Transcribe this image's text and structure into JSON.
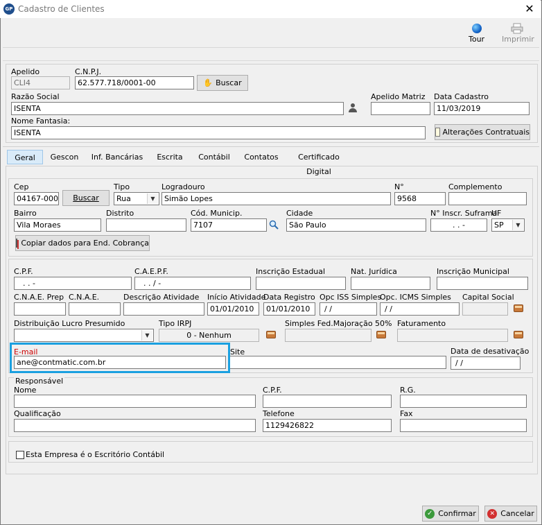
{
  "window": {
    "app_icon": "GP",
    "title": "Cadastro de Clientes",
    "close": "✕"
  },
  "toolbar": {
    "tour": "Tour",
    "imprimir": "Imprimir"
  },
  "header": {
    "apelido_label": "Apelido",
    "apelido_value": "CLI4",
    "cnpj_label": "C.N.P.J.",
    "cnpj_value": "62.577.718/0001-00",
    "buscar_label": "Buscar",
    "razao_label": "Razão Social",
    "razao_value": "ISENTA",
    "apelido_matriz_label": "Apelido Matriz",
    "apelido_matriz_value": "",
    "data_cadastro_label": "Data Cadastro",
    "data_cadastro_value": "11/03/2019",
    "nome_fantasia_label": "Nome Fantasia:",
    "nome_fantasia_value": "ISENTA",
    "alteracoes_label": "Alterações Contratuais"
  },
  "tabs": [
    "Geral",
    "Gescon",
    "Inf. Bancárias",
    "Escrita",
    "Contábil",
    "Contatos",
    "Certificado Digital"
  ],
  "address": {
    "cep_label": "Cep",
    "cep_value": "04167-000",
    "buscar_label": "Buscar",
    "tipo_label": "Tipo",
    "tipo_value": "Rua",
    "logradouro_label": "Logradouro",
    "logradouro_value": "Simão Lopes",
    "numero_label": "N°",
    "numero_value": "9568",
    "complemento_label": "Complemento",
    "complemento_value": "",
    "bairro_label": "Bairro",
    "bairro_value": "Vila Moraes",
    "distrito_label": "Distrito",
    "distrito_value": "",
    "cod_municip_label": "Cód. Municip.",
    "cod_municip_value": "7107",
    "cidade_label": "Cidade",
    "cidade_value": "São Paulo",
    "suframa_label": "N° Inscr. Suframa",
    "suframa_value": ". . -",
    "uf_label": "UF",
    "uf_value": "SP",
    "copiar_label": "Copiar dados para End. Cobrança"
  },
  "fiscal": {
    "cpf_label": "C.P.F.",
    "cpf_value": ". . -",
    "caepf_label": "C.A.E.P.F.",
    "caepf_value": ". . / -",
    "ie_label": "Inscrição Estadual",
    "ie_value": "",
    "nat_juridica_label": "Nat. Jurídica",
    "nat_juridica_value": "",
    "im_label": "Inscrição Municipal",
    "im_value": "",
    "cnae_prep_label": "C.N.A.E. Prep",
    "cnae_label": "C.N.A.E.",
    "desc_atividade_label": "Descrição Atividade",
    "inicio_atividade_label": "Início Atividade",
    "inicio_atividade_value": "01/01/2010",
    "data_registro_label": "Data Registro",
    "data_registro_value": "01/01/2010",
    "opc_iss_label": "Opc ISS Simples",
    "opc_iss_value": "/ /",
    "opc_icms_label": "Opc. ICMS Simples",
    "opc_icms_value": "/ /",
    "capital_social_label": "Capital Social",
    "distribuicao_label": "Distribuição Lucro Presumido",
    "tipo_irpj_label": "Tipo IRPJ",
    "tipo_irpj_value": "0 - Nenhum",
    "simples_label": "Simples Fed.Majoração 50%",
    "faturamento_label": "Faturamento",
    "email_label": "E-mail",
    "email_value": "ane@contmatic.com.br",
    "site_label": "Site",
    "site_value": "",
    "desativacao_label": "Data de desativação",
    "desativacao_value": "/ /"
  },
  "responsavel": {
    "title": "Responsável",
    "nome_label": "Nome",
    "cpf_label": "C.P.F.",
    "rg_label": "R.G.",
    "qualificacao_label": "Qualificação",
    "telefone_label": "Telefone",
    "telefone_value": "1129426822",
    "fax_label": "Fax"
  },
  "escritorio_label": "Esta Empresa é o Escritório Contábil",
  "footer": {
    "confirmar": "Confirmar",
    "cancelar": "Cancelar"
  },
  "colors": {
    "highlight": "#1aa0e0",
    "email_label": "#cc0000",
    "tab_selected": "#d9ebf9"
  }
}
